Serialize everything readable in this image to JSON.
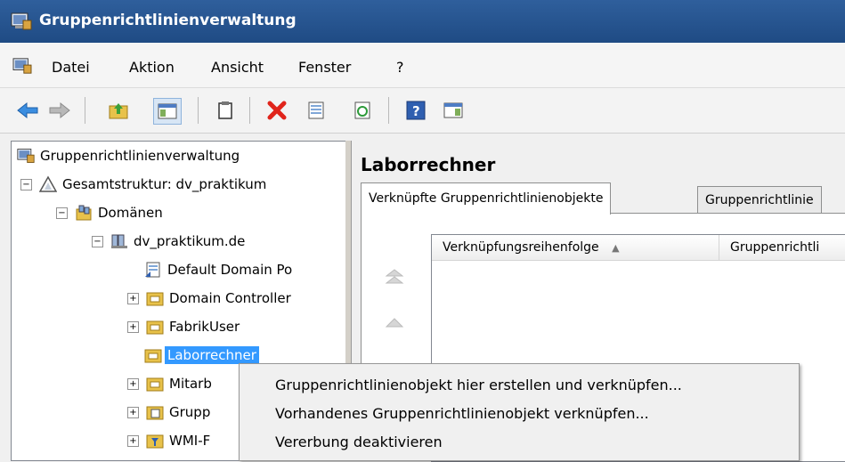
{
  "window": {
    "title": "Gruppenrichtlinienverwaltung",
    "title_icon": "gpmc-console-icon"
  },
  "menu": [
    "Datei",
    "Aktion",
    "Ansicht",
    "Fenster",
    "?"
  ],
  "toolbar": {
    "icons": [
      "back-arrow-icon",
      "forward-arrow-icon",
      "up-folder-icon",
      "show-hide-tree-icon",
      "copy-icon",
      "delete-icon",
      "properties-icon",
      "refresh-icon",
      "help-icon",
      "action-pane-icon"
    ]
  },
  "tree": {
    "root": "Gruppenrichtlinienverwaltung",
    "forest": "Gesamtstruktur: dv_praktikum",
    "domains": "Domänen",
    "domain": "dv_praktikum.de",
    "items": [
      {
        "label": "Default Domain Po",
        "icon": "gpo-link-icon",
        "expander": ""
      },
      {
        "label": "Domain Controller",
        "icon": "ou-folder-icon",
        "expander": "+"
      },
      {
        "label": "FabrikUser",
        "icon": "ou-folder-icon",
        "expander": "+"
      },
      {
        "label": "Laborrechner",
        "icon": "ou-folder-icon",
        "expander": "",
        "selected": true
      },
      {
        "label": "Mitarb",
        "icon": "ou-folder-icon",
        "expander": "+"
      },
      {
        "label": "Grupp",
        "icon": "gpo-container-icon",
        "expander": "+"
      },
      {
        "label": "WMI-F",
        "icon": "wmi-filter-icon",
        "expander": "+"
      }
    ]
  },
  "details": {
    "heading": "Laborrechner",
    "tabs": [
      "Verknüpfte Gruppenrichtlinienobjekte",
      "Gruppenrichtlinie"
    ],
    "columns": [
      "Verknüpfungsreihenfolge",
      "Gruppenrichtli"
    ],
    "sort_indicator": "▲"
  },
  "context_menu": {
    "items": [
      "Gruppenrichtlinienobjekt hier erstellen und verknüpfen...",
      "Vorhandenes Gruppenrichtlinienobjekt verknüpfen...",
      "Vererbung deaktivieren"
    ]
  },
  "colors": {
    "titlebar": "#1f4b84",
    "selection": "#3399ff",
    "folder": "#e8c24a"
  }
}
